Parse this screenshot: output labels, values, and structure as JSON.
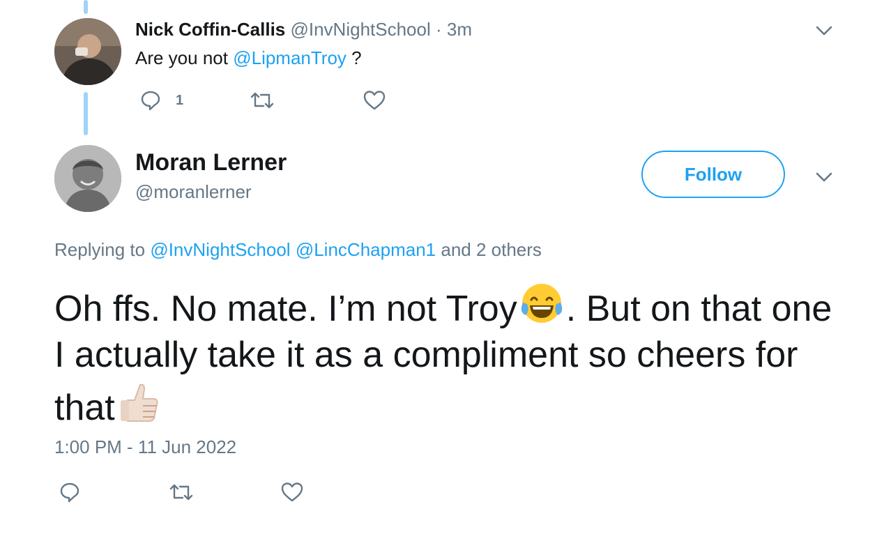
{
  "reply_tweet": {
    "author_name": "Nick Coffin-Callis",
    "author_handle": "@InvNightSchool",
    "separator": "·",
    "time_ago": "3m",
    "text_prefix": "Are you not",
    "mention": "@LipmanTroy",
    "text_suffix": "?",
    "reply_count": "1"
  },
  "main_tweet": {
    "author_name": "Moran Lerner",
    "author_handle": "@moranlerner",
    "follow_label": "Follow",
    "replying_prefix": "Replying to",
    "replying_mention_1": "@InvNightSchool",
    "replying_mention_2": "@LincChapman1",
    "replying_suffix": "and 2 others",
    "text_part_1": "Oh ffs. No mate. I’m not Troy",
    "text_part_2": ". But on that one I actually take it as a compliment so cheers for that",
    "timestamp": "1:00 PM - 11 Jun 2022"
  },
  "icons": {
    "reply": "reply-icon",
    "retweet": "retweet-icon",
    "like": "heart-icon",
    "more": "chevron-down-icon",
    "laugh_emoji": "tears-of-joy-emoji",
    "thumbs_emoji": "thumbs-up-emoji"
  },
  "colors": {
    "accent": "#1da1f2",
    "muted_text": "#657786",
    "primary_text": "#14171a",
    "thread_line": "#9fd3f7"
  }
}
